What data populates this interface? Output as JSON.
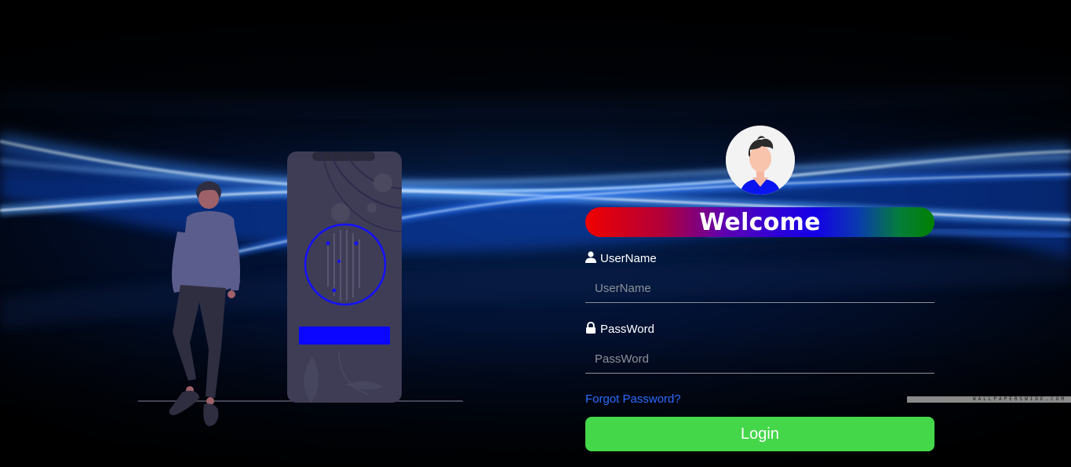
{
  "welcome": {
    "title": "Welcome"
  },
  "username": {
    "label": "UserName",
    "placeholder": "UserName",
    "value": ""
  },
  "password": {
    "label": "PassWord",
    "placeholder": "PassWord",
    "value": ""
  },
  "forgot_link": "Forgot Password?",
  "login_button": "Login",
  "watermark": "WALLPAPERSWIDE.COM",
  "icons": {
    "username": "user-icon",
    "password": "lock-icon",
    "avatar": "user-avatar"
  },
  "colors": {
    "login_button": "#45d74a",
    "forgot_link": "#2d6cff",
    "welcome_gradient_start": "#f00000",
    "welcome_gradient_mid": "#1400e6",
    "welcome_gradient_end": "#008000",
    "background": "#000000",
    "glow": "#1e6cff"
  }
}
